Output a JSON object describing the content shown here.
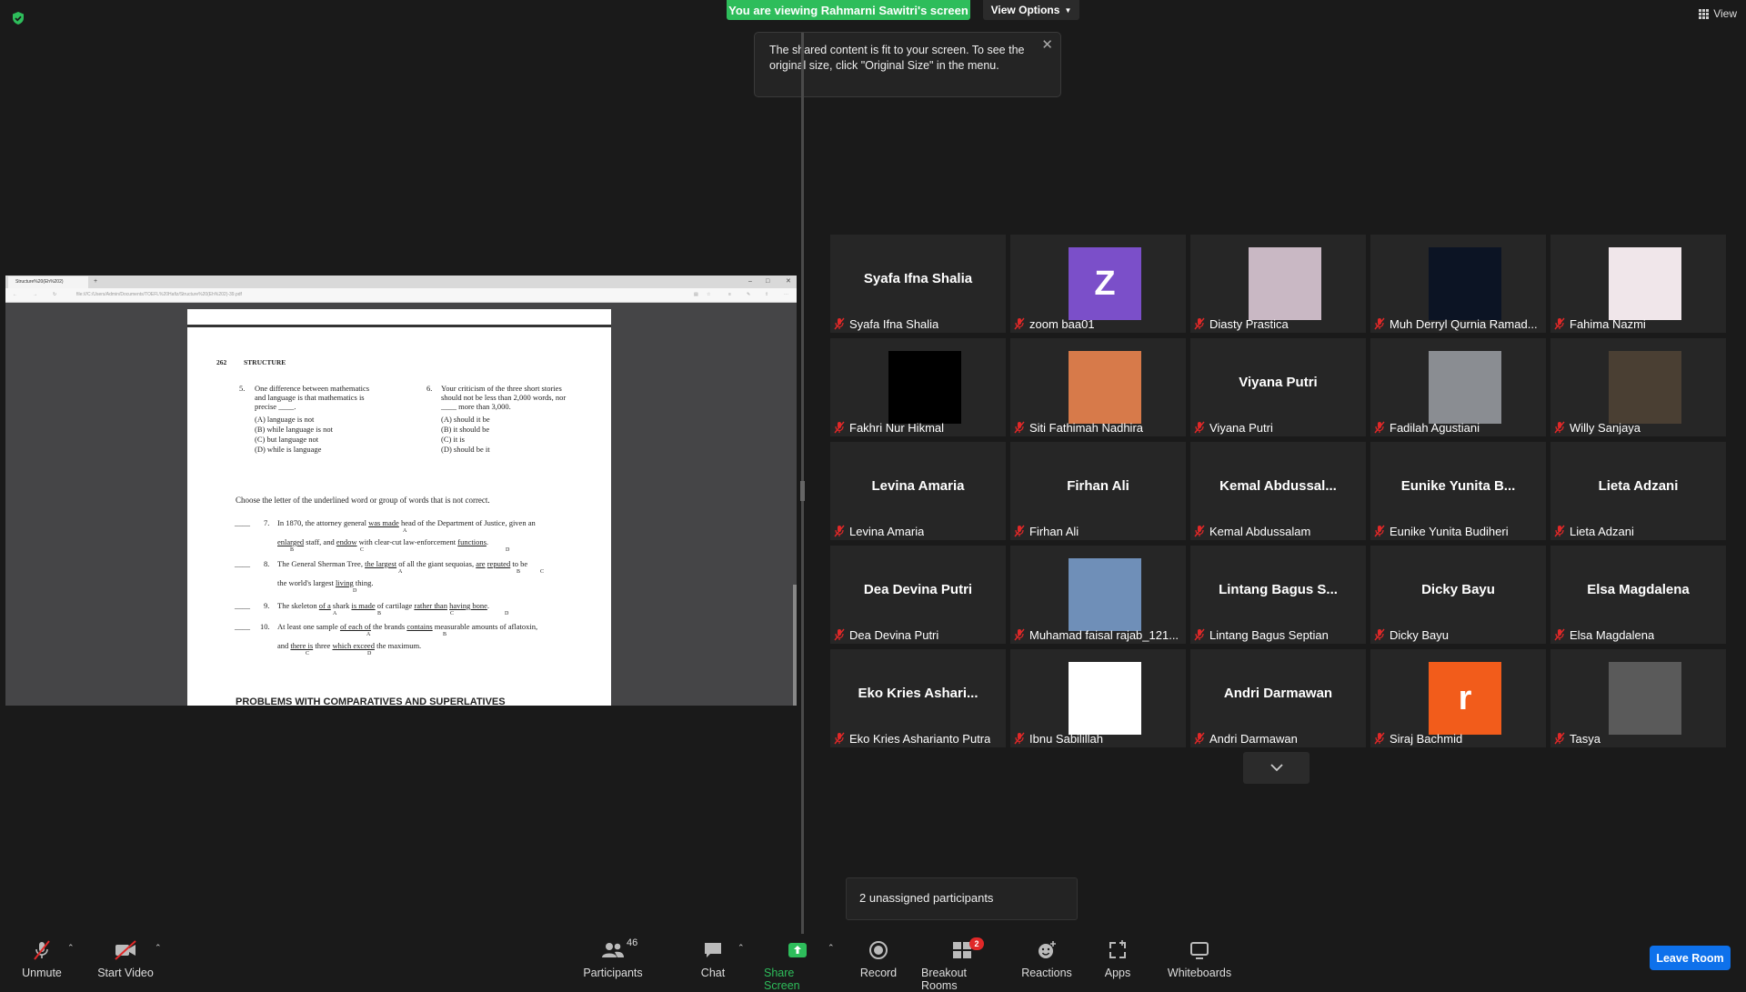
{
  "banner": {
    "viewing": "You are viewing Rahmarni Sawitri's screen",
    "view_options": "View Options",
    "view": "View"
  },
  "tooltip": {
    "text": "The shared content is fit to your screen. To see the original size, click \"Original Size\" in the menu."
  },
  "browser": {
    "tab_title": "Structure%20(Eh%202)",
    "url": "file:///C:/Users/Admin/Documents/TOEFL%20Hafiz/Structure%20(Eh%202)-39.pdf"
  },
  "pdf": {
    "page_num": "262",
    "section": "STRUCTURE",
    "q5": {
      "num": "5.",
      "l1": "One difference between mathematics",
      "l2": "and language is that mathematics is",
      "l3": "precise ____.",
      "options": [
        "(A)   language is not",
        "(B)   while language is not",
        "(C)   but language not",
        "(D)   while is language"
      ]
    },
    "q6": {
      "num": "6.",
      "l1": "Your criticism of the three short stories",
      "l2": "should not be less than 2,000 words, nor",
      "l3": "____ more than 3,000.",
      "options": [
        "(A)   should it be",
        "(B)   it should be",
        "(C)   it is",
        "(D)   should be it"
      ]
    },
    "instruction": "Choose the letter of the underlined word or group of words that is not correct.",
    "q7": {
      "num": "7.",
      "l1a": "In 1870, the attorney general ",
      "l1b": "was made",
      "l1c": " head of the Department of Justice, given an",
      "l2a": "enlarged",
      "l2b": " staff, and ",
      "l2c": "endow",
      "l2d": " with clear-cut law-enforcement ",
      "l2e": "functions",
      "l2f": ".",
      "A": "A",
      "B": "B",
      "C": "C",
      "D": "D"
    },
    "q8": {
      "num": "8.",
      "l1a": "The General Sherman Tree, ",
      "l1b": "the largest",
      "l1c": " of all the giant sequoias, ",
      "l1d": "are",
      "l1e": " ",
      "l1f": "reputed",
      "l1g": " to be",
      "l2a": "the world's largest ",
      "l2b": "living",
      "l2c": " thing.",
      "A": "A",
      "B": "B",
      "C": "C",
      "D": "D"
    },
    "q9": {
      "num": "9.",
      "a": "The skeleton ",
      "b": "of a",
      "c": " shark ",
      "d": "is made",
      "e": " of cartilage ",
      "f": "rather than",
      "g": " ",
      "h": "having bone",
      "i": ".",
      "A": "A",
      "B": "B",
      "C": "C",
      "D": "D"
    },
    "q10": {
      "num": "10.",
      "l1a": "At least one sample ",
      "l1b": "of each of",
      "l1c": " the brands ",
      "l1d": "contains",
      "l1e": " measurable amounts of aflatoxin,",
      "l2a": "and ",
      "l2b": "there is",
      "l2c": " three ",
      "l2d": "which exceed",
      "l2e": " the maximum.",
      "A": "A",
      "B": "B",
      "C": "C",
      "D": "D"
    },
    "next_heading": "PROBLEMS WITH COMPARATIVES AND SUPERLATIVES",
    "blank": "____"
  },
  "participants": [
    {
      "display": "Syafa Ifna Shalia",
      "name": "Syafa Ifna Shalia",
      "kind": "text"
    },
    {
      "display": "",
      "name": "zoom baa01",
      "kind": "letter",
      "letter": "Z",
      "color": "#7b4fc9"
    },
    {
      "display": "",
      "name": "Diasty Prastica",
      "kind": "photo",
      "color": "#c9b8c4"
    },
    {
      "display": "",
      "name": "Muh Derryl Qurnia Ramad...",
      "kind": "photo",
      "color": "#0c1424"
    },
    {
      "display": "",
      "name": "Fahima Nazmi",
      "kind": "photo",
      "color": "#f0e6ea"
    },
    {
      "display": "",
      "name": "Fakhri Nur Hikmal",
      "kind": "photo",
      "color": "#000000"
    },
    {
      "display": "",
      "name": "Siti Fathimah Nadhira",
      "kind": "photo",
      "color": "#d77a4a"
    },
    {
      "display": "Viyana Putri",
      "name": "Viyana Putri",
      "kind": "text"
    },
    {
      "display": "",
      "name": "Fadilah Agustiani",
      "kind": "photo",
      "color": "#8a8d92"
    },
    {
      "display": "",
      "name": "Willy Sanjaya",
      "kind": "photo",
      "color": "#4a3f33"
    },
    {
      "display": "Levina Amaria",
      "name": "Levina Amaria",
      "kind": "text"
    },
    {
      "display": "Firhan Ali",
      "name": "Firhan Ali",
      "kind": "text"
    },
    {
      "display": "Kemal Abdussal...",
      "name": "Kemal Abdussalam",
      "kind": "text"
    },
    {
      "display": "Eunike Yunita B...",
      "name": "Eunike Yunita Budiheri",
      "kind": "text"
    },
    {
      "display": "Lieta Adzani",
      "name": "Lieta Adzani",
      "kind": "text"
    },
    {
      "display": "Dea Devina Putri",
      "name": "Dea Devina Putri",
      "kind": "text"
    },
    {
      "display": "",
      "name": "Muhamad faisal rajab_121...",
      "kind": "photo",
      "color": "#6f8fb8"
    },
    {
      "display": "Lintang Bagus S...",
      "name": "Lintang Bagus Septian",
      "kind": "text"
    },
    {
      "display": "Dicky Bayu",
      "name": "Dicky Bayu",
      "kind": "text"
    },
    {
      "display": "Elsa Magdalena",
      "name": "Elsa Magdalena",
      "kind": "text"
    },
    {
      "display": "Eko Kries Ashari...",
      "name": "Eko Kries Asharianto Putra",
      "kind": "text"
    },
    {
      "display": "",
      "name": "Ibnu Sabilillah",
      "kind": "photo",
      "color": "#ffffff"
    },
    {
      "display": "Andri Darmawan",
      "name": "Andri Darmawan",
      "kind": "text"
    },
    {
      "display": "",
      "name": "Siraj Bachmid",
      "kind": "letter",
      "letter": "r",
      "color": "#f25c1b"
    },
    {
      "display": "",
      "name": "Tasya",
      "kind": "photo",
      "color": "#5a5a5a"
    }
  ],
  "unassigned": "2 unassigned participants",
  "toolbar": {
    "unmute": "Unmute",
    "start_video": "Start Video",
    "participants": "Participants",
    "participants_count": "46",
    "chat": "Chat",
    "share_screen": "Share Screen",
    "record": "Record",
    "breakout_rooms": "Breakout Rooms",
    "breakout_badge": "2",
    "reactions": "Reactions",
    "apps": "Apps",
    "whiteboards": "Whiteboards",
    "leave": "Leave Room"
  },
  "colors": {
    "share_green": "#2ebd5b",
    "leave_blue": "#0e71eb",
    "muted_red": "#e02828"
  }
}
